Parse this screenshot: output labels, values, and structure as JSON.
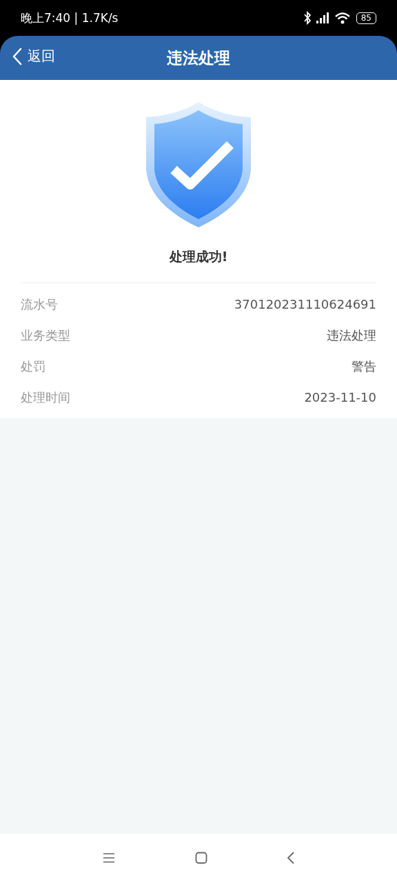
{
  "status_bar": {
    "time": "晚上7:40 | 1.7K/s",
    "battery": "85"
  },
  "header": {
    "back": "返回",
    "title": "违法处理"
  },
  "result": {
    "message": "处理成功!"
  },
  "details": [
    {
      "label": "流水号",
      "value": "370120231110624691"
    },
    {
      "label": "业务类型",
      "value": "违法处理"
    },
    {
      "label": "处罚",
      "value": "警告"
    },
    {
      "label": "处理时间",
      "value": "2023-11-10"
    }
  ]
}
